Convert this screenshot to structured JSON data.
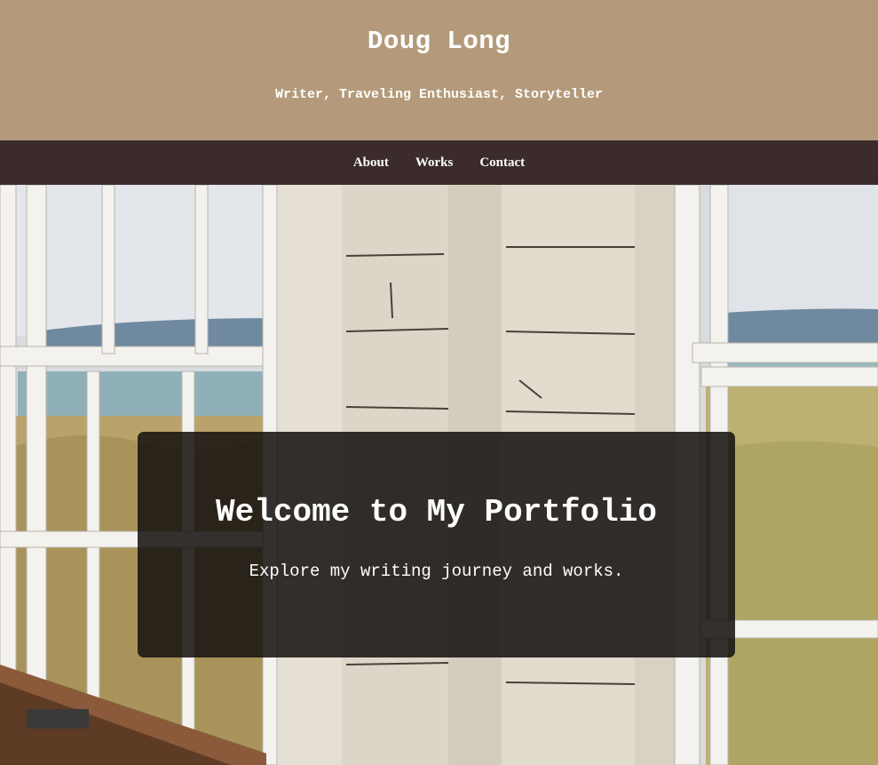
{
  "header": {
    "title": "Doug Long",
    "tagline": "Writer, Traveling Enthusiast, Storyteller"
  },
  "nav": {
    "items": [
      {
        "label": "About"
      },
      {
        "label": "Works"
      },
      {
        "label": "Contact"
      }
    ]
  },
  "hero": {
    "heading": "Welcome to My Portfolio",
    "text": "Explore my writing journey and works."
  },
  "colors": {
    "header_bg": "#b49a7b",
    "nav_bg": "#3b2b2b",
    "card_bg": "rgba(20,16,14,0.86)",
    "text": "#ffffff"
  }
}
